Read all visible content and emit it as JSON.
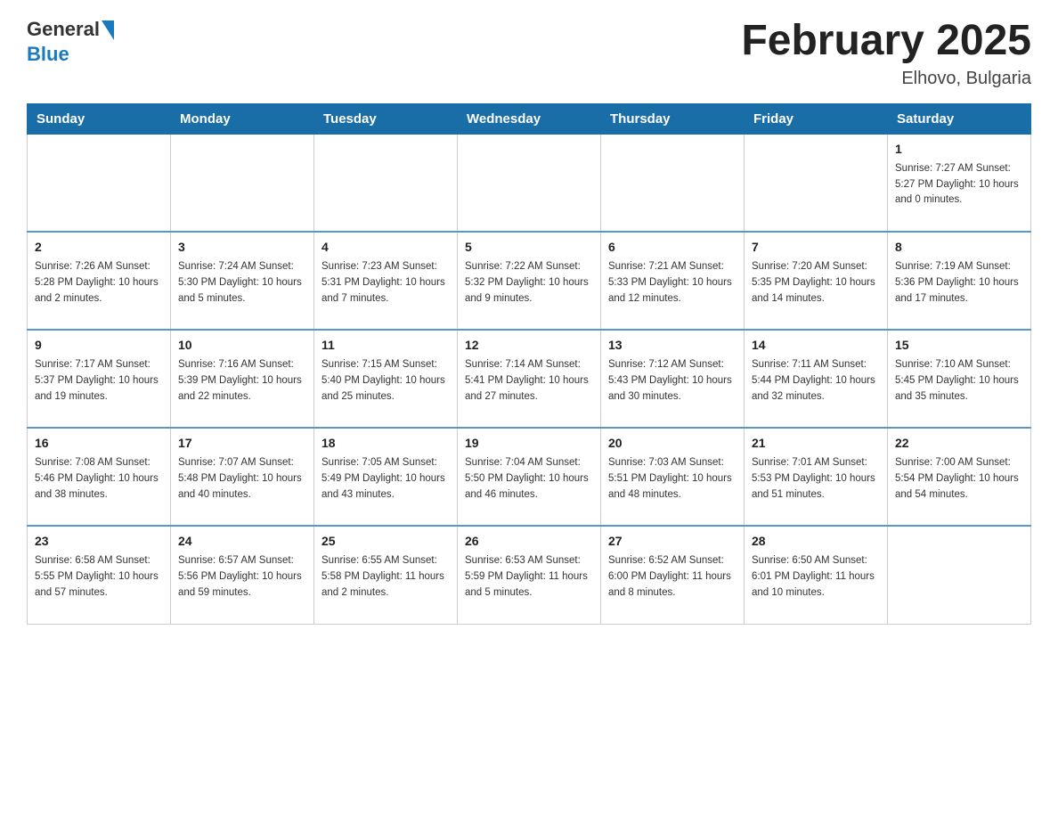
{
  "header": {
    "logo_general": "General",
    "logo_blue": "Blue",
    "title": "February 2025",
    "subtitle": "Elhovo, Bulgaria"
  },
  "days_of_week": [
    "Sunday",
    "Monday",
    "Tuesday",
    "Wednesday",
    "Thursday",
    "Friday",
    "Saturday"
  ],
  "weeks": [
    [
      {
        "day": "",
        "info": ""
      },
      {
        "day": "",
        "info": ""
      },
      {
        "day": "",
        "info": ""
      },
      {
        "day": "",
        "info": ""
      },
      {
        "day": "",
        "info": ""
      },
      {
        "day": "",
        "info": ""
      },
      {
        "day": "1",
        "info": "Sunrise: 7:27 AM\nSunset: 5:27 PM\nDaylight: 10 hours and 0 minutes."
      }
    ],
    [
      {
        "day": "2",
        "info": "Sunrise: 7:26 AM\nSunset: 5:28 PM\nDaylight: 10 hours and 2 minutes."
      },
      {
        "day": "3",
        "info": "Sunrise: 7:24 AM\nSunset: 5:30 PM\nDaylight: 10 hours and 5 minutes."
      },
      {
        "day": "4",
        "info": "Sunrise: 7:23 AM\nSunset: 5:31 PM\nDaylight: 10 hours and 7 minutes."
      },
      {
        "day": "5",
        "info": "Sunrise: 7:22 AM\nSunset: 5:32 PM\nDaylight: 10 hours and 9 minutes."
      },
      {
        "day": "6",
        "info": "Sunrise: 7:21 AM\nSunset: 5:33 PM\nDaylight: 10 hours and 12 minutes."
      },
      {
        "day": "7",
        "info": "Sunrise: 7:20 AM\nSunset: 5:35 PM\nDaylight: 10 hours and 14 minutes."
      },
      {
        "day": "8",
        "info": "Sunrise: 7:19 AM\nSunset: 5:36 PM\nDaylight: 10 hours and 17 minutes."
      }
    ],
    [
      {
        "day": "9",
        "info": "Sunrise: 7:17 AM\nSunset: 5:37 PM\nDaylight: 10 hours and 19 minutes."
      },
      {
        "day": "10",
        "info": "Sunrise: 7:16 AM\nSunset: 5:39 PM\nDaylight: 10 hours and 22 minutes."
      },
      {
        "day": "11",
        "info": "Sunrise: 7:15 AM\nSunset: 5:40 PM\nDaylight: 10 hours and 25 minutes."
      },
      {
        "day": "12",
        "info": "Sunrise: 7:14 AM\nSunset: 5:41 PM\nDaylight: 10 hours and 27 minutes."
      },
      {
        "day": "13",
        "info": "Sunrise: 7:12 AM\nSunset: 5:43 PM\nDaylight: 10 hours and 30 minutes."
      },
      {
        "day": "14",
        "info": "Sunrise: 7:11 AM\nSunset: 5:44 PM\nDaylight: 10 hours and 32 minutes."
      },
      {
        "day": "15",
        "info": "Sunrise: 7:10 AM\nSunset: 5:45 PM\nDaylight: 10 hours and 35 minutes."
      }
    ],
    [
      {
        "day": "16",
        "info": "Sunrise: 7:08 AM\nSunset: 5:46 PM\nDaylight: 10 hours and 38 minutes."
      },
      {
        "day": "17",
        "info": "Sunrise: 7:07 AM\nSunset: 5:48 PM\nDaylight: 10 hours and 40 minutes."
      },
      {
        "day": "18",
        "info": "Sunrise: 7:05 AM\nSunset: 5:49 PM\nDaylight: 10 hours and 43 minutes."
      },
      {
        "day": "19",
        "info": "Sunrise: 7:04 AM\nSunset: 5:50 PM\nDaylight: 10 hours and 46 minutes."
      },
      {
        "day": "20",
        "info": "Sunrise: 7:03 AM\nSunset: 5:51 PM\nDaylight: 10 hours and 48 minutes."
      },
      {
        "day": "21",
        "info": "Sunrise: 7:01 AM\nSunset: 5:53 PM\nDaylight: 10 hours and 51 minutes."
      },
      {
        "day": "22",
        "info": "Sunrise: 7:00 AM\nSunset: 5:54 PM\nDaylight: 10 hours and 54 minutes."
      }
    ],
    [
      {
        "day": "23",
        "info": "Sunrise: 6:58 AM\nSunset: 5:55 PM\nDaylight: 10 hours and 57 minutes."
      },
      {
        "day": "24",
        "info": "Sunrise: 6:57 AM\nSunset: 5:56 PM\nDaylight: 10 hours and 59 minutes."
      },
      {
        "day": "25",
        "info": "Sunrise: 6:55 AM\nSunset: 5:58 PM\nDaylight: 11 hours and 2 minutes."
      },
      {
        "day": "26",
        "info": "Sunrise: 6:53 AM\nSunset: 5:59 PM\nDaylight: 11 hours and 5 minutes."
      },
      {
        "day": "27",
        "info": "Sunrise: 6:52 AM\nSunset: 6:00 PM\nDaylight: 11 hours and 8 minutes."
      },
      {
        "day": "28",
        "info": "Sunrise: 6:50 AM\nSunset: 6:01 PM\nDaylight: 11 hours and 10 minutes."
      },
      {
        "day": "",
        "info": ""
      }
    ]
  ]
}
